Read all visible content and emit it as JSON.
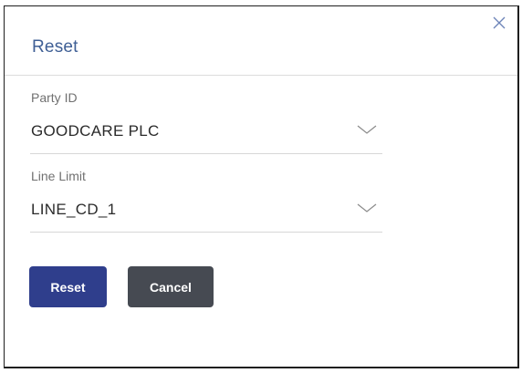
{
  "dialog": {
    "title": "Reset",
    "close_icon": "close-icon"
  },
  "fields": {
    "party_id": {
      "label": "Party ID",
      "value": "GOODCARE PLC",
      "icon": "chevron-down-icon"
    },
    "line_limit": {
      "label": "Line Limit",
      "value": "LINE_CD_1",
      "icon": "chevron-down-icon"
    }
  },
  "buttons": {
    "reset_label": "Reset",
    "cancel_label": "Cancel"
  },
  "colors": {
    "title": "#3f5f95",
    "primary_button": "#2f3e8c",
    "secondary_button": "#464a52"
  }
}
